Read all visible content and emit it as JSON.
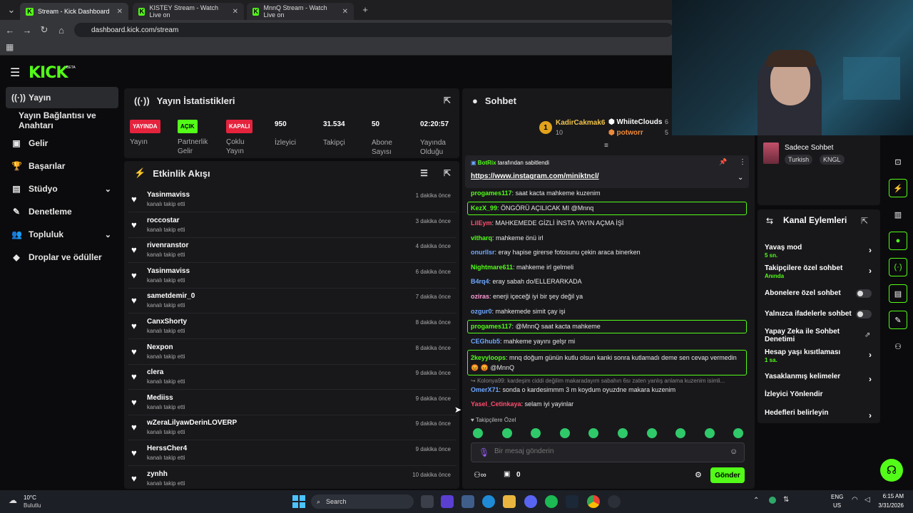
{
  "browser": {
    "tabs": [
      {
        "label": "Stream - Kick Dashboard"
      },
      {
        "label": "KISTEY Stream - Watch Live on"
      },
      {
        "label": "MnnQ Stream - Watch Live on"
      }
    ],
    "url": "dashboard.kick.com/stream"
  },
  "brand": {
    "logo": "KICK",
    "beta": "BETA",
    "accent": "#53fc18"
  },
  "sidebar": {
    "items": [
      {
        "label": "Yayın",
        "icon": "broadcast-icon"
      },
      {
        "label": "Yayın Bağlantısı ve Anahtarı"
      },
      {
        "label": "Gelir",
        "icon": "money-icon"
      },
      {
        "label": "Başarılar",
        "icon": "trophy-icon"
      },
      {
        "label": "Stüdyo",
        "icon": "studio-icon"
      },
      {
        "label": "Denetleme",
        "icon": "wrench-icon"
      },
      {
        "label": "Topluluk",
        "icon": "community-icon"
      },
      {
        "label": "Droplar ve ödüller",
        "icon": "gift-icon"
      }
    ]
  },
  "stats": {
    "title": "Yayın İstatistikleri",
    "items": [
      {
        "badge": "YAYINDA",
        "label": "Yayın"
      },
      {
        "badge": "AÇIK",
        "label": "Partnerlik Gelir"
      },
      {
        "badge": "KAPALI",
        "label": "Çoklu Yayın"
      },
      {
        "value": "950",
        "label": "İzleyici"
      },
      {
        "value": "31.534",
        "label": "Takipçi"
      },
      {
        "value": "50",
        "label": "Abone Sayısı"
      },
      {
        "value": "02:20:57",
        "label": "Yayında Olduğu Sü..."
      }
    ]
  },
  "activity": {
    "title": "Etkinlik Akışı",
    "events": [
      {
        "name": "Yasinmaviss",
        "sub": "kanalı takip etti",
        "time": "1 dakika önce"
      },
      {
        "name": "roccostar",
        "sub": "kanalı takip etti",
        "time": "3 dakika önce"
      },
      {
        "name": "rivenranstor",
        "sub": "kanalı takip etti",
        "time": "4 dakika önce"
      },
      {
        "name": "Yasinmaviss",
        "sub": "kanalı takip etti",
        "time": "6 dakika önce"
      },
      {
        "name": "sametdemir_0",
        "sub": "kanalı takip etti",
        "time": "7 dakika önce"
      },
      {
        "name": "CanxShorty",
        "sub": "kanalı takip etti",
        "time": "8 dakika önce"
      },
      {
        "name": "Nexpon",
        "sub": "kanalı takip etti",
        "time": "8 dakika önce"
      },
      {
        "name": "clera",
        "sub": "kanalı takip etti",
        "time": "9 dakika önce"
      },
      {
        "name": "Mediiss",
        "sub": "kanalı takip etti",
        "time": "9 dakika önce"
      },
      {
        "name": "wZeraLilyawDerinLOVERP",
        "sub": "kanalı takip etti",
        "time": "9 dakika önce"
      },
      {
        "name": "HerssCher4",
        "sub": "kanalı takip etti",
        "time": "9 dakika önce"
      },
      {
        "name": "zynhh",
        "sub": "kanalı takip etti",
        "time": "10 dakika önce"
      }
    ]
  },
  "chat": {
    "title": "Sohbet",
    "leaderboard": [
      {
        "rank": "1",
        "name": "KadirCakmak6",
        "count": "10"
      },
      {
        "name": "WhiiteClouds",
        "count": "6"
      },
      {
        "name": "potworr",
        "count": "5"
      }
    ],
    "pinned": {
      "by": "BotRix",
      "suffix": "tarafından sabitlendi",
      "link": "https://www.instagram.com/miniktncl/"
    },
    "messages": [
      {
        "user": "progames117",
        "color": "#53fc18",
        "text": "saat kacta mahkeme kuzenim"
      },
      {
        "user": "KezX_99",
        "color": "#53fc18",
        "text": "ÖNGÖRÜ AÇILICAK MI @Mnnq",
        "highlight": true
      },
      {
        "user": "LilEym",
        "color": "#ff4d6d",
        "text": "MAHKEMEDE GİZLİ İNSTA YAYIN AÇMA İŞİ"
      },
      {
        "user": "vitharq",
        "color": "#53fc18",
        "text": "mahkeme önü irl"
      },
      {
        "user": "onurllsr",
        "color": "#6ea8ff",
        "text": "eray hapise girerse fotosunu çekin araca binerken"
      },
      {
        "user": "Nightmare611",
        "color": "#53fc18",
        "text": "mahkeme irl gelmeli"
      },
      {
        "user": "B4rq4",
        "color": "#6ea8ff",
        "text": "eray sabah do/ELLERARKADA"
      },
      {
        "user": "oziras",
        "color": "#ff9ad5",
        "text": "enerji içeceği iyi bir şey değil ya"
      },
      {
        "user": "ozgur0",
        "color": "#6ea8ff",
        "text": "mahkemede simit çay işi"
      },
      {
        "user": "progames117",
        "color": "#53fc18",
        "text": "@MnnQ saat kacta mahkeme",
        "highlight": true
      },
      {
        "user": "CEGhub5",
        "color": "#6ea8ff",
        "text": "mahkeme yayını gelşr mi"
      },
      {
        "user": "2keyyloops",
        "color": "#53fc18",
        "text": "mnq doğum günün kutlu olsun kanki sonra kutlamadı deme sen cevap vermedin 😡 😡 @MnnQ",
        "highlight": true
      },
      {
        "user": "",
        "color": "#888888",
        "text": "Kolonya99: kardeşim ciddi değilim makaradayım sabahın 6sı zaten yanlış anlama kuzenim isimli..."
      },
      {
        "user": "OmerX71",
        "color": "#6ea8ff",
        "text": "sonda o kardesimmm 3 m koydum oyuzdne makara kuzenim"
      },
      {
        "user": "Yasel_Cetinkaya",
        "color": "#ff4d6d",
        "text": "selam iyi yayinlar"
      }
    ],
    "emote_label": "Takipçilere Özel",
    "input_placeholder": "Bir mesaj gönderin",
    "count": "0",
    "send_label": "Gönder"
  },
  "right": {
    "chat_mode_header": "Sadece Sohbet",
    "tags": [
      "Turkish",
      "KNGL"
    ],
    "actions_title": "Kanal Eylemleri",
    "actions": [
      {
        "label": "Yavaş mod",
        "sub": "5 sn.",
        "control": "arrow"
      },
      {
        "label": "Takipçilere özel sohbet",
        "sub": "Anında",
        "control": "arrow"
      },
      {
        "label": "Abonelere özel sohbet",
        "control": "toggle",
        "on": false
      },
      {
        "label": "Yalnızca ifadelerle sohbet",
        "control": "toggle",
        "on": false
      },
      {
        "label": "Yapay Zeka ile Sohbet Denetimi",
        "control": "external"
      },
      {
        "label": "Hesap yaşı kısıtlaması",
        "sub": "1 sa.",
        "control": "arrow"
      },
      {
        "label": "Yasaklanmış kelimeler",
        "control": "arrow"
      },
      {
        "label": "İzleyici Yönlendir",
        "control": "none"
      },
      {
        "label": "Hedefleri belirleyin",
        "control": "arrow"
      }
    ]
  },
  "taskbar": {
    "weather_temp": "10°C",
    "weather_text": "Bulutlu",
    "search": "Search",
    "lang": "ENG",
    "region": "US",
    "time": "6:15 AM",
    "date": "3/31/2026"
  }
}
